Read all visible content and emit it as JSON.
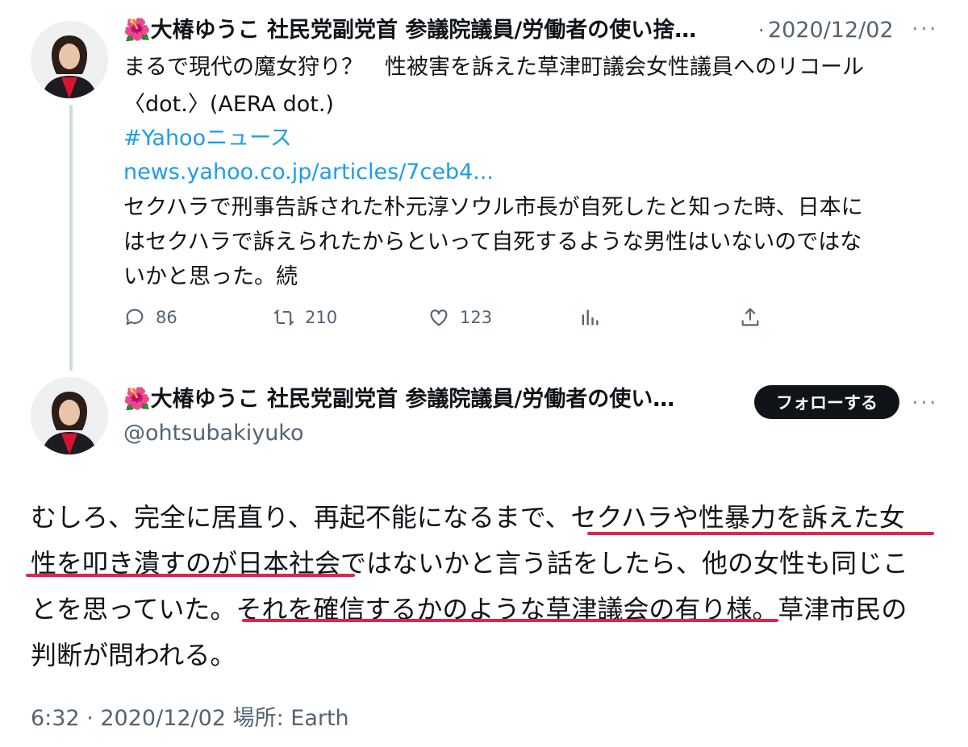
{
  "tweet1": {
    "display_name": "🌺大椿ゆうこ 社民党副党首 参議院議員/労働者の使い捨…",
    "sep": "·",
    "date": "2020/12/02",
    "more": "···",
    "line1": "まるで現代の魔女狩り？　性被害を訴えた草津町議会女性議員へのリコール",
    "line2": "〈dot.〉(AERA dot.)",
    "hashtag": "#Yahooニュース",
    "link": "news.yahoo.co.jp/articles/7ceb4...",
    "line5": "セクハラで刑事告訴された朴元淳ソウル市長が自死したと知った時、日本に",
    "line6": "はセクハラで訴えられたからといって自死するような男性はいないのではな",
    "line7": "いかと思った。続",
    "actions": {
      "replies": "86",
      "retweets": "210",
      "likes": "123"
    },
    "icons": [
      "reply-icon",
      "retweet-icon",
      "like-icon",
      "views-icon",
      "share-icon"
    ]
  },
  "tweet2": {
    "display_name": "🌺大椿ゆうこ 社民党副党首 参議院議員/労働者の使い…",
    "follow_label": "フォローする",
    "more": "···",
    "handle": "@ohtsubakiyuko",
    "body": {
      "l1_a": "むしろ、完全に居直り、再起不能になるまで、",
      "l1_b": "セクハラや性暴力を訴えた女",
      "l2_a": "性を叩き潰すのが日本社会",
      "l2_b": "ではないかと言う話をしたら、他の女性も同じこ",
      "l3_a": "とを思っていた。",
      "l3_b": "それを確信するかのような草津議会の有り様",
      "l3_c": "。草津市民の",
      "l4": "判断が問われる。"
    },
    "meta": "6:32 · 2020/12/02 場所: Earth"
  },
  "colors": {
    "link": "#1d9bf0",
    "underline": "#e0244a",
    "follow_bg": "#0f1419",
    "thread_line": "#cfd9de"
  }
}
